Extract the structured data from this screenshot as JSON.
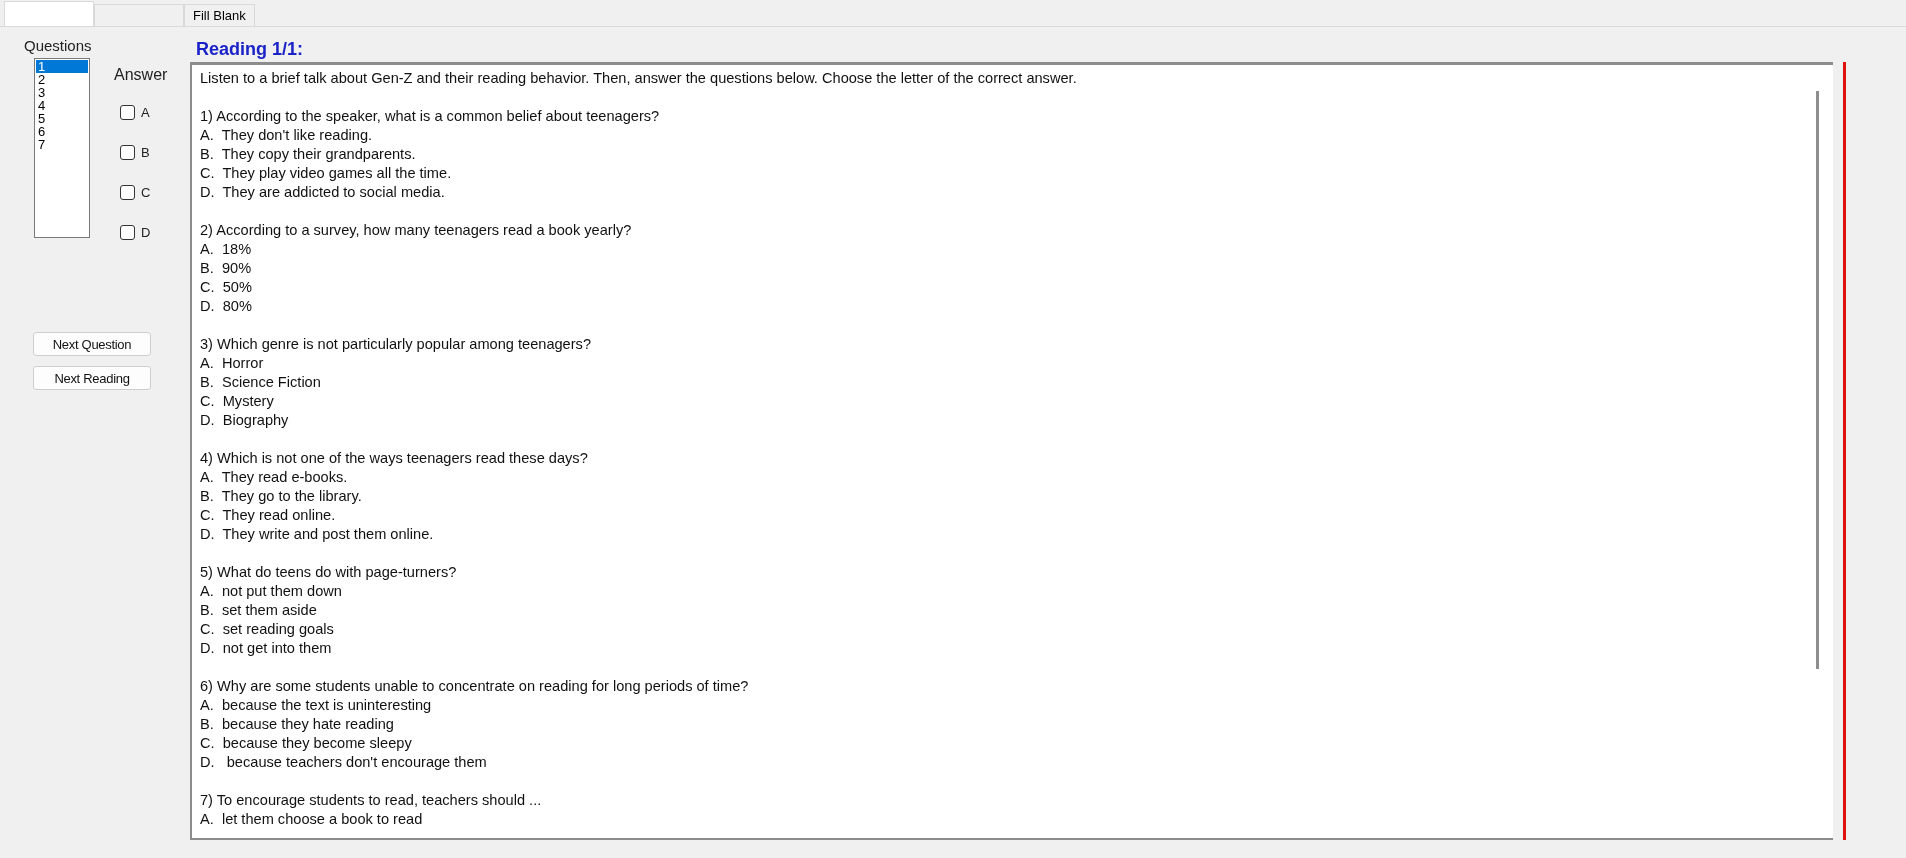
{
  "tabs": [
    {
      "selected": true
    },
    {
      "selected": false
    },
    {
      "label": "Fill Blank",
      "selected": false
    }
  ],
  "questions_panel": {
    "title": "Questions",
    "items": [
      {
        "label": "1",
        "selected": true
      },
      {
        "label": "2",
        "selected": false
      },
      {
        "label": "3",
        "selected": false
      },
      {
        "label": "4",
        "selected": false
      },
      {
        "label": "5",
        "selected": false
      },
      {
        "label": "6",
        "selected": false
      },
      {
        "label": "7",
        "selected": false
      }
    ]
  },
  "answer": {
    "title": "Answer",
    "options": [
      {
        "label": "A",
        "checked": false
      },
      {
        "label": "B",
        "checked": false
      },
      {
        "label": "C",
        "checked": false
      },
      {
        "label": "D",
        "checked": false
      }
    ]
  },
  "buttons": [
    "Next Question",
    "Next Reading"
  ],
  "reading": {
    "title": "Reading 1/1:",
    "intro": "Listen to a brief talk about Gen-Z and their reading behavior. Then, answer the questions below. Choose the letter of the correct answer.",
    "questions": [
      {
        "text": "1) According to the speaker, what is a common belief about teenagers?",
        "options": [
          "A.  They don't like reading.",
          "B.  They copy their grandparents.",
          "C.  They play video games all the time.",
          "D.  They are addicted to social media."
        ]
      },
      {
        "text": "2) According to a survey, how many teenagers read a book yearly?",
        "options": [
          "A.  18%",
          "B.  90%",
          "C.  50%",
          "D.  80%"
        ]
      },
      {
        "text": "3) Which genre is not particularly popular among teenagers?",
        "options": [
          "A.  Horror",
          "B.  Science Fiction",
          "C.  Mystery",
          "D.  Biography"
        ]
      },
      {
        "text": "4) Which is not one of the ways teenagers read these days?",
        "options": [
          "A.  They read e-books.",
          "B.  They go to the library.",
          "C.  They read online.",
          "D.  They write and post them online."
        ]
      },
      {
        "text": "5) What do teens do with page-turners?",
        "options": [
          "A.  not put them down",
          "B.  set them aside",
          "C.  set reading goals",
          "D.  not get into them"
        ]
      },
      {
        "text": "6) Why are some students unable to concentrate on reading for long periods of time?",
        "options": [
          "A.  because the text is uninteresting",
          "B.  because they hate reading",
          "C.  because they become sleepy",
          "D.   because teachers don't encourage them"
        ]
      },
      {
        "text": "7) To encourage students to read, teachers should ...",
        "options": [
          "A.  let them choose a book to read"
        ]
      }
    ]
  }
}
